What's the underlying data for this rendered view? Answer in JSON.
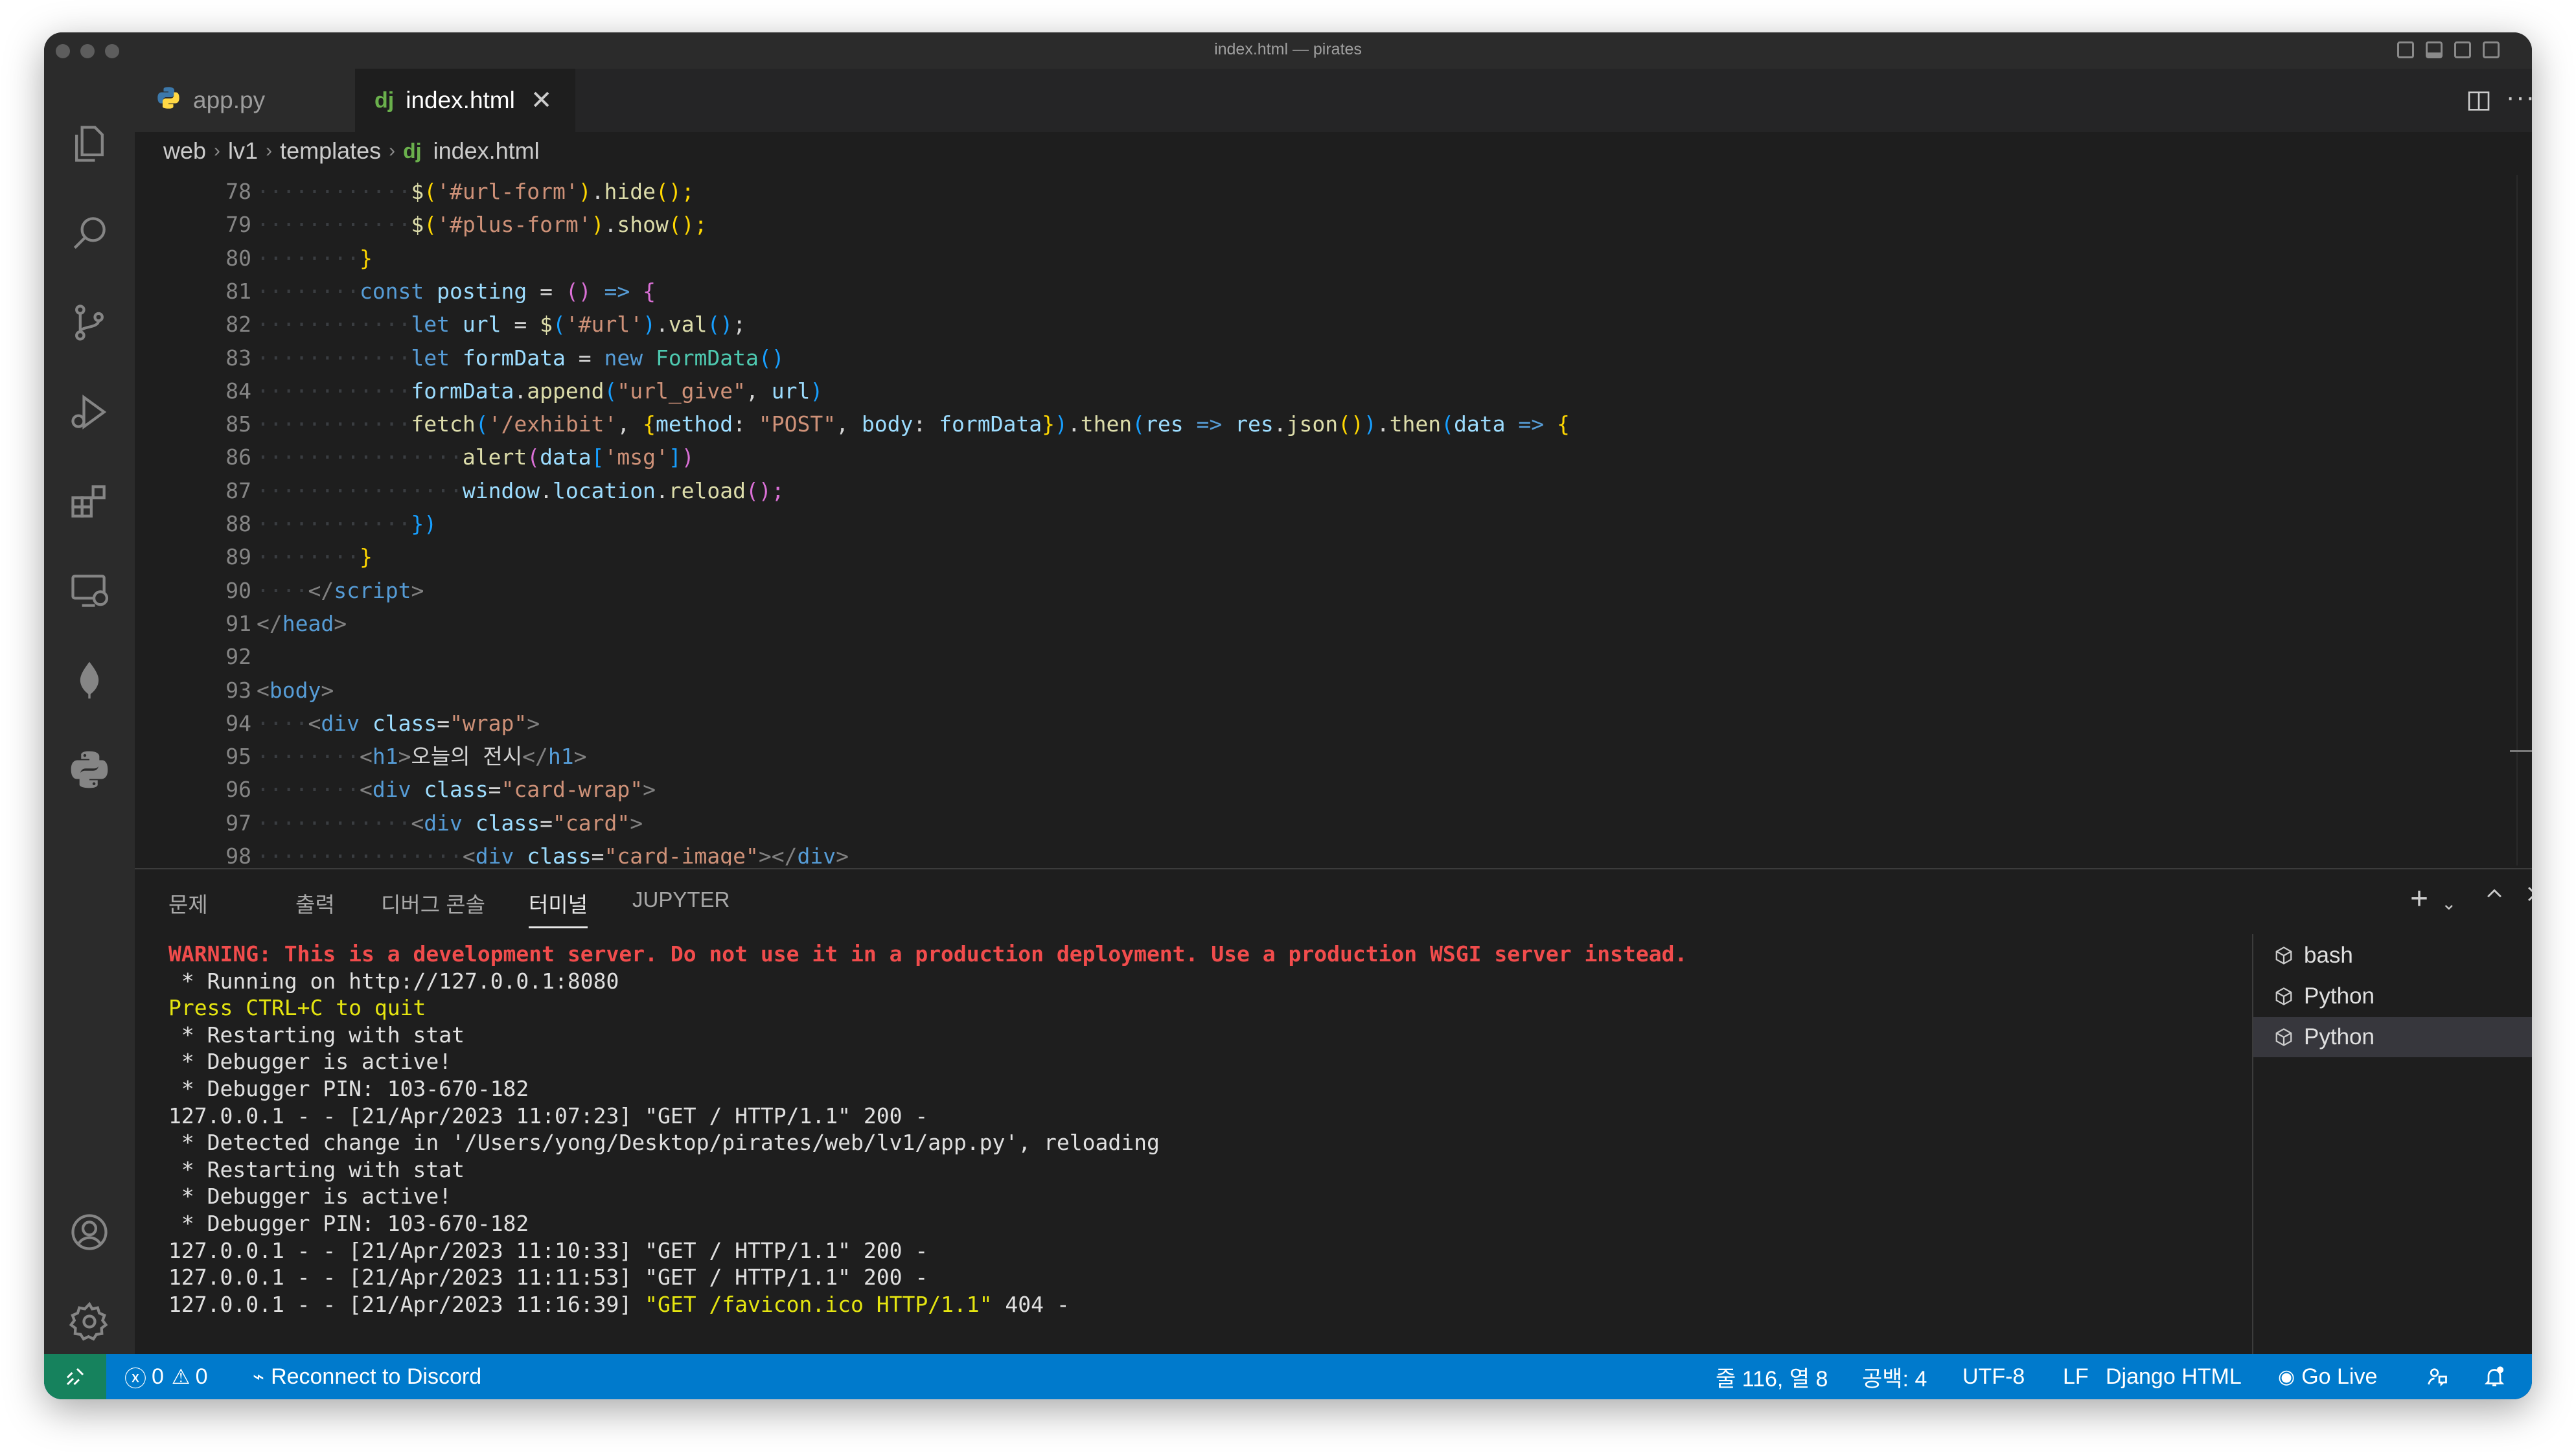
{
  "window": {
    "title": "index.html — pirates"
  },
  "tabs": [
    {
      "label": "app.py",
      "icon": "python-file-icon",
      "active": false
    },
    {
      "label": "index.html",
      "icon": "django-file-icon",
      "icon_text": "dj",
      "active": true
    }
  ],
  "breadcrumb": {
    "items": [
      "web",
      "lv1",
      "templates"
    ],
    "file": "index.html",
    "file_icon_text": "dj"
  },
  "editor": {
    "lines": [
      {
        "n": "78",
        "indent": 3,
        "tokens": [
          [
            "$",
            "fn"
          ],
          [
            "(",
            "y"
          ],
          [
            "'#url-form'",
            "str"
          ],
          [
            ")",
            "y"
          ],
          [
            ".",
            "pl"
          ],
          [
            "hide",
            "fn"
          ],
          [
            "();",
            "y"
          ]
        ]
      },
      {
        "n": "79",
        "indent": 3,
        "tokens": [
          [
            "$",
            "fn"
          ],
          [
            "(",
            "y"
          ],
          [
            "'#plus-form'",
            "str"
          ],
          [
            ")",
            "y"
          ],
          [
            ".",
            "pl"
          ],
          [
            "show",
            "fn"
          ],
          [
            "();",
            "y"
          ]
        ]
      },
      {
        "n": "80",
        "indent": 2,
        "tokens": [
          [
            "}",
            "y"
          ]
        ]
      },
      {
        "n": "81",
        "indent": 2,
        "tokens": [
          [
            "const",
            "kw"
          ],
          [
            " ",
            "pl"
          ],
          [
            "posting",
            "var"
          ],
          [
            " = ",
            "pl"
          ],
          [
            "()",
            "p"
          ],
          [
            " => ",
            "kw"
          ],
          [
            "{",
            "p"
          ]
        ]
      },
      {
        "n": "82",
        "indent": 3,
        "tokens": [
          [
            "let",
            "kw"
          ],
          [
            " ",
            "pl"
          ],
          [
            "url",
            "var"
          ],
          [
            " = ",
            "pl"
          ],
          [
            "$",
            "fn"
          ],
          [
            "(",
            "b"
          ],
          [
            "'#url'",
            "str"
          ],
          [
            ")",
            "b"
          ],
          [
            ".",
            "pl"
          ],
          [
            "val",
            "fn"
          ],
          [
            "()",
            "b"
          ],
          [
            ";",
            "pl"
          ]
        ]
      },
      {
        "n": "83",
        "indent": 3,
        "tokens": [
          [
            "let",
            "kw"
          ],
          [
            " ",
            "pl"
          ],
          [
            "formData",
            "var"
          ],
          [
            " = ",
            "pl"
          ],
          [
            "new",
            "kw"
          ],
          [
            " ",
            "pl"
          ],
          [
            "FormData",
            "cls"
          ],
          [
            "()",
            "b"
          ]
        ]
      },
      {
        "n": "84",
        "indent": 3,
        "tokens": [
          [
            "formData",
            "var"
          ],
          [
            ".",
            "pl"
          ],
          [
            "append",
            "fn"
          ],
          [
            "(",
            "b"
          ],
          [
            "\"url_give\"",
            "str"
          ],
          [
            ", ",
            "pl"
          ],
          [
            "url",
            "var"
          ],
          [
            ")",
            "b"
          ]
        ]
      },
      {
        "n": "85",
        "indent": 3,
        "tokens": [
          [
            "fetch",
            "fn"
          ],
          [
            "(",
            "b"
          ],
          [
            "'/exhibit'",
            "str"
          ],
          [
            ", ",
            "pl"
          ],
          [
            "{",
            "y"
          ],
          [
            "method",
            "var"
          ],
          [
            ": ",
            "pl"
          ],
          [
            "\"POST\"",
            "str"
          ],
          [
            ", ",
            "pl"
          ],
          [
            "body",
            "var"
          ],
          [
            ": ",
            "pl"
          ],
          [
            "formData",
            "var"
          ],
          [
            "}",
            "y"
          ],
          [
            ")",
            "b"
          ],
          [
            ".",
            "pl"
          ],
          [
            "then",
            "fn"
          ],
          [
            "(",
            "b"
          ],
          [
            "res",
            "var"
          ],
          [
            " => ",
            "kw"
          ],
          [
            "res",
            "var"
          ],
          [
            ".",
            "pl"
          ],
          [
            "json",
            "fn"
          ],
          [
            "()",
            "y"
          ],
          [
            ")",
            "b"
          ],
          [
            ".",
            "pl"
          ],
          [
            "then",
            "fn"
          ],
          [
            "(",
            "b"
          ],
          [
            "data",
            "var"
          ],
          [
            " => ",
            "kw"
          ],
          [
            "{",
            "y"
          ]
        ]
      },
      {
        "n": "86",
        "indent": 4,
        "tokens": [
          [
            "alert",
            "fn"
          ],
          [
            "(",
            "p"
          ],
          [
            "data",
            "var"
          ],
          [
            "[",
            "b"
          ],
          [
            "'msg'",
            "str"
          ],
          [
            "]",
            "b"
          ],
          [
            ")",
            "p"
          ]
        ]
      },
      {
        "n": "87",
        "indent": 4,
        "tokens": [
          [
            "window",
            "var"
          ],
          [
            ".",
            "pl"
          ],
          [
            "location",
            "var"
          ],
          [
            ".",
            "pl"
          ],
          [
            "reload",
            "fn"
          ],
          [
            "();",
            "p"
          ]
        ]
      },
      {
        "n": "88",
        "indent": 3,
        "tokens": [
          [
            "})",
            "b"
          ]
        ]
      },
      {
        "n": "89",
        "indent": 2,
        "tokens": [
          [
            "}",
            "y"
          ]
        ]
      },
      {
        "n": "90",
        "indent": 1,
        "tokens": [
          [
            "</",
            "br"
          ],
          [
            "script",
            "tag"
          ],
          [
            ">",
            "br"
          ]
        ]
      },
      {
        "n": "91",
        "indent": 0,
        "tokens": [
          [
            "</",
            "br"
          ],
          [
            "head",
            "tag"
          ],
          [
            ">",
            "br"
          ]
        ]
      },
      {
        "n": "92",
        "indent": 0,
        "tokens": []
      },
      {
        "n": "93",
        "indent": 0,
        "tokens": [
          [
            "<",
            "br"
          ],
          [
            "body",
            "tag"
          ],
          [
            ">",
            "br"
          ]
        ]
      },
      {
        "n": "94",
        "indent": 1,
        "tokens": [
          [
            "<",
            "br"
          ],
          [
            "div",
            "tag"
          ],
          [
            " ",
            "pl"
          ],
          [
            "class",
            "attr"
          ],
          [
            "=",
            "pl"
          ],
          [
            "\"wrap\"",
            "str"
          ],
          [
            ">",
            "br"
          ]
        ]
      },
      {
        "n": "95",
        "indent": 2,
        "tokens": [
          [
            "<",
            "br"
          ],
          [
            "h1",
            "tag"
          ],
          [
            ">",
            "br"
          ],
          [
            "오늘의 전시",
            "pl"
          ],
          [
            "</",
            "br"
          ],
          [
            "h1",
            "tag"
          ],
          [
            ">",
            "br"
          ]
        ]
      },
      {
        "n": "96",
        "indent": 2,
        "tokens": [
          [
            "<",
            "br"
          ],
          [
            "div",
            "tag"
          ],
          [
            " ",
            "pl"
          ],
          [
            "class",
            "attr"
          ],
          [
            "=",
            "pl"
          ],
          [
            "\"card-wrap\"",
            "str"
          ],
          [
            ">",
            "br"
          ]
        ]
      },
      {
        "n": "97",
        "indent": 3,
        "tokens": [
          [
            "<",
            "br"
          ],
          [
            "div",
            "tag"
          ],
          [
            " ",
            "pl"
          ],
          [
            "class",
            "attr"
          ],
          [
            "=",
            "pl"
          ],
          [
            "\"card\"",
            "str"
          ],
          [
            ">",
            "br"
          ]
        ]
      },
      {
        "n": "98",
        "indent": 4,
        "tokens": [
          [
            "<",
            "br"
          ],
          [
            "div",
            "tag"
          ],
          [
            " ",
            "pl"
          ],
          [
            "class",
            "attr"
          ],
          [
            "=",
            "pl"
          ],
          [
            "\"card-image\"",
            "str"
          ],
          [
            "></",
            "br"
          ],
          [
            "div",
            "tag"
          ],
          [
            ">",
            "br"
          ]
        ]
      }
    ]
  },
  "panel": {
    "tabs": [
      "문제",
      "출력",
      "디버그 콘솔",
      "터미널",
      "JUPYTER"
    ],
    "active_tab": "터미널",
    "terminal_lines": [
      {
        "text": "WARNING: This is a development server. Do not use it in a production deployment. Use a production WSGI server instead.",
        "style": "warn"
      },
      {
        "text": " * Running on http://127.0.0.1:8080",
        "style": "normal"
      },
      {
        "text": "Press CTRL+C to quit",
        "style": "yel"
      },
      {
        "text": " * Restarting with stat",
        "style": "normal"
      },
      {
        "text": " * Debugger is active!",
        "style": "normal"
      },
      {
        "text": " * Debugger PIN: 103-670-182",
        "style": "normal"
      },
      {
        "text": "127.0.0.1 - - [21/Apr/2023 11:07:23] \"GET / HTTP/1.1\" 200 -",
        "style": "normal"
      },
      {
        "text": " * Detected change in '/Users/yong/Desktop/pirates/web/lv1/app.py', reloading",
        "style": "normal"
      },
      {
        "text": " * Restarting with stat",
        "style": "normal"
      },
      {
        "text": " * Debugger is active!",
        "style": "normal"
      },
      {
        "text": " * Debugger PIN: 103-670-182",
        "style": "normal"
      },
      {
        "text": "127.0.0.1 - - [21/Apr/2023 11:10:33] \"GET / HTTP/1.1\" 200 -",
        "style": "normal"
      },
      {
        "text": "127.0.0.1 - - [21/Apr/2023 11:11:53] \"GET / HTTP/1.1\" 200 -",
        "style": "normal"
      },
      {
        "text": "127.0.0.1 - - [21/Apr/2023 11:16:39] ",
        "highlight": "\"GET /favicon.ico HTTP/1.1\"",
        "tail": " 404 -",
        "style": "mixed"
      }
    ],
    "terminals": [
      {
        "label": "bash",
        "selected": false
      },
      {
        "label": "Python",
        "selected": false
      },
      {
        "label": "Python",
        "selected": true
      }
    ]
  },
  "statusbar": {
    "errors": "0",
    "warnings": "0",
    "discord": "Reconnect to Discord",
    "position": "줄 116, 열 8",
    "spaces": "공백: 4",
    "encoding": "UTF-8",
    "eol": "LF",
    "language": "Django HTML",
    "golive": "Go Live"
  },
  "colors": {
    "status_bg": "#007acc",
    "remote_bg": "#16825d",
    "editor_bg": "#1e1e1e",
    "activity_bg": "#2b2b2b",
    "warning_text": "#f14c4c",
    "terminal_yellow": "#e5e510"
  }
}
